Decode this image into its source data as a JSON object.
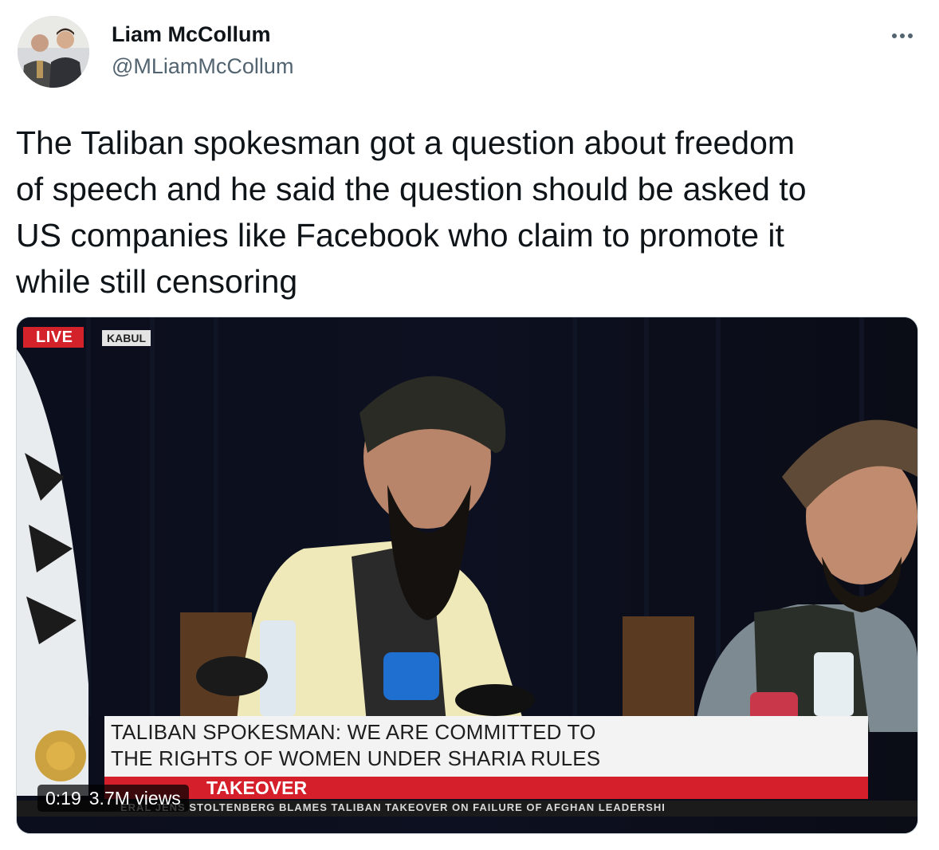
{
  "author": {
    "name": "Liam McCollum",
    "handle": "@MLiamMcCollum"
  },
  "tweet": {
    "text_lines": [
      "The Taliban spokesman got a question about freedom",
      "of speech and he said the question should be asked to",
      "US companies like Facebook who claim to promote it",
      "while still censoring"
    ]
  },
  "more_icon": "more-horizontal-icon",
  "video": {
    "live_badge": "LIVE",
    "location_badge": "KABUL",
    "headline_lines": [
      "TALIBAN SPOKESMAN: WE ARE COMMITTED TO",
      "THE RIGHTS OF WOMEN UNDER SHARIA RULES"
    ],
    "section_label": "TAKEOVER",
    "ticker_text": "ERAL JENS STOLTENBERG BLAMES TALIBAN TAKEOVER ON FAILURE OF AFGHAN LEADERSHI",
    "duration": "0:19",
    "views": "3.7M views"
  },
  "colors": {
    "live_red": "#d3222a",
    "handle_gray": "#536471"
  }
}
